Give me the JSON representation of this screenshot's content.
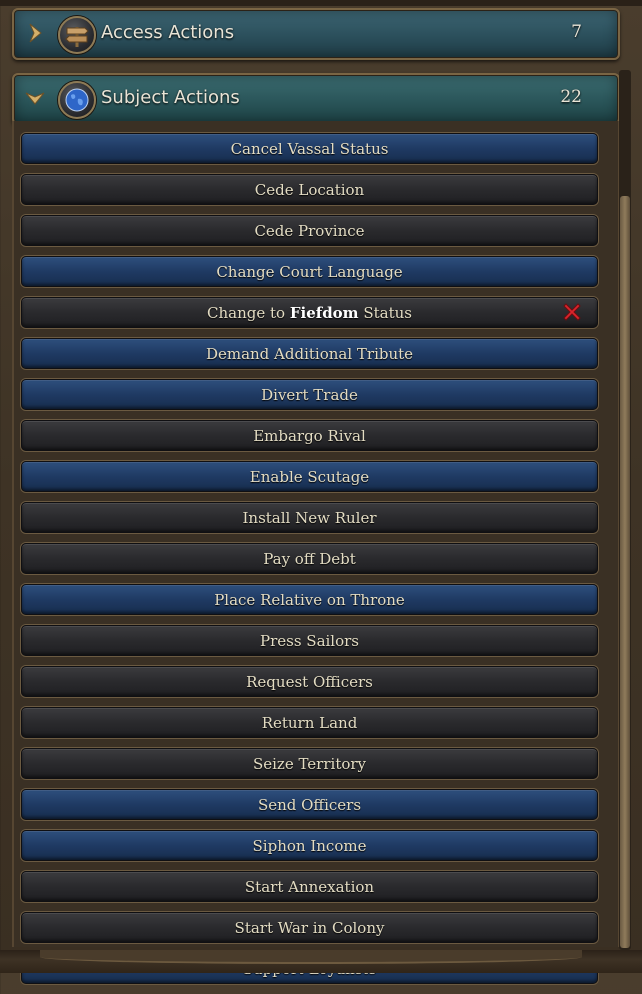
{
  "categories": [
    {
      "title": "Access Actions",
      "count": "7",
      "expanded": false,
      "icon": "signpost-icon",
      "chevron": "chevron-right-icon"
    },
    {
      "title": "Subject Actions",
      "count": "22",
      "expanded": true,
      "icon": "globe-icon",
      "chevron": "chevron-down-icon"
    }
  ],
  "actions": [
    {
      "label": "Cancel Vassal Status",
      "style": "blue"
    },
    {
      "label": "Cede Location",
      "style": "dark"
    },
    {
      "label": "Cede Province",
      "style": "dark"
    },
    {
      "label": "Change Court Language",
      "style": "blue"
    },
    {
      "label_pre": "Change to ",
      "label_bold": "Fiefdom",
      "label_post": " Status",
      "style": "dark",
      "unavailable": true,
      "status_icon": "red-x-icon"
    },
    {
      "label": "Demand Additional Tribute",
      "style": "blue"
    },
    {
      "label": "Divert Trade",
      "style": "blue"
    },
    {
      "label": "Embargo Rival",
      "style": "dark"
    },
    {
      "label": "Enable Scutage",
      "style": "blue"
    },
    {
      "label": "Install New Ruler",
      "style": "dark"
    },
    {
      "label": "Pay off Debt",
      "style": "dark"
    },
    {
      "label": "Place Relative on Throne",
      "style": "blue"
    },
    {
      "label": "Press Sailors",
      "style": "dark"
    },
    {
      "label": "Request Officers",
      "style": "dark"
    },
    {
      "label": "Return Land",
      "style": "dark"
    },
    {
      "label": "Seize Territory",
      "style": "dark"
    },
    {
      "label": "Send Officers",
      "style": "blue"
    },
    {
      "label": "Siphon Income",
      "style": "blue"
    },
    {
      "label": "Start Annexation",
      "style": "dark"
    },
    {
      "label": "Start War in Colony",
      "style": "dark"
    },
    {
      "label": "Support Loyalists",
      "style": "blue"
    }
  ],
  "colors": {
    "header_teal": "#2b4f5b",
    "action_blue": "#1f3a63",
    "action_dark": "#2a2a2d",
    "text": "#e3dcc3",
    "gold_border": "#7a6544",
    "x_red": "#d9252c"
  }
}
